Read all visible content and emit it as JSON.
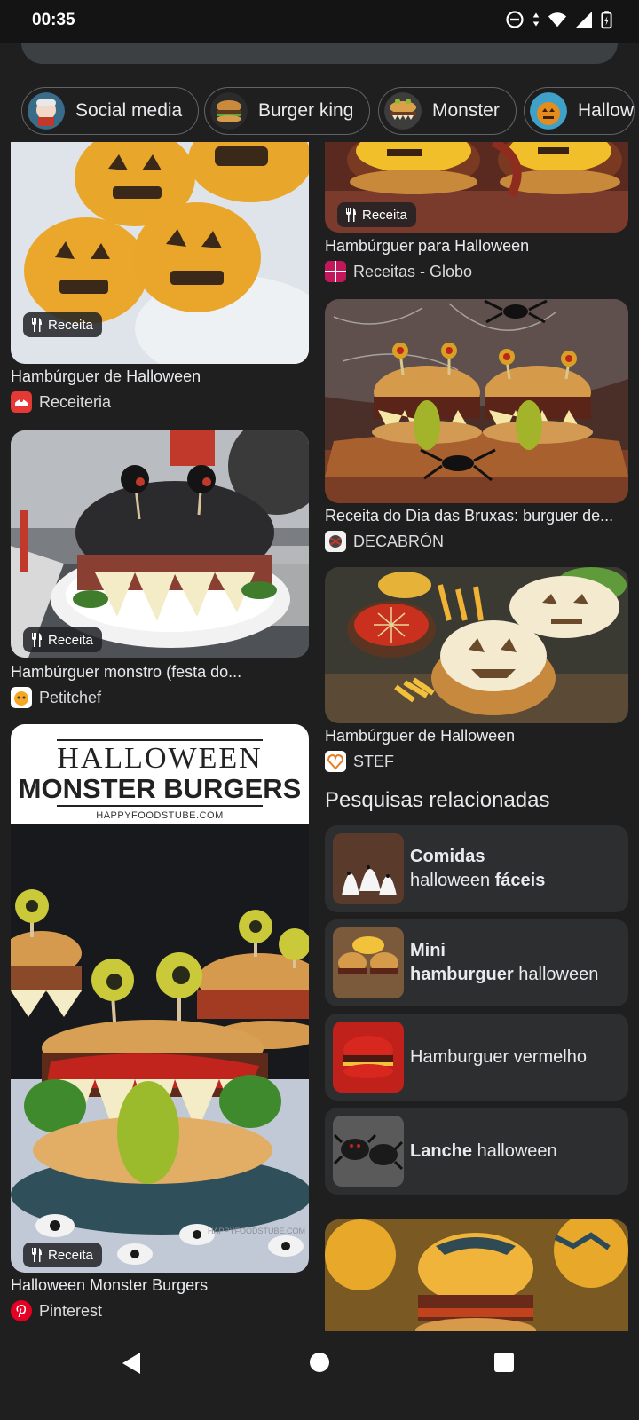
{
  "status_bar": {
    "time": "00:35",
    "icons": [
      "do-not-disturb-icon",
      "wifi-icon",
      "signal-icon",
      "battery-icon"
    ]
  },
  "chips": [
    {
      "label": "Social media",
      "thumb": "social-media-thumb"
    },
    {
      "label": "Burger king",
      "thumb": "burger-king-thumb"
    },
    {
      "label": "Monster",
      "thumb": "monster-thumb"
    },
    {
      "label": "Hallow",
      "thumb": "halloween-thumb"
    }
  ],
  "badge_label": "Receita",
  "left_column": [
    {
      "title": "Hambúrguer de Halloween",
      "source": "Receiteria"
    },
    {
      "title": "Hambúrguer monstro (festa do...",
      "source": "Petitchef"
    },
    {
      "title": "Halloween Monster Burgers",
      "source": "Pinterest",
      "image_text": {
        "line1": "HALLOWEEN",
        "line2": "MONSTER BURGERS",
        "site": "HAPPYFOODSTUBE.COM",
        "watermark": "HAPPYFOODSTUBE.COM"
      }
    }
  ],
  "right_column": [
    {
      "title": "Hambúrguer para Halloween",
      "source": "Receitas - Globo"
    },
    {
      "title": "Receita do Dia das Bruxas: burguer de...",
      "source": "DECABRÓN"
    },
    {
      "title": "Hambúrguer de Halloween",
      "source": "STEF"
    }
  ],
  "related": {
    "heading": "Pesquisas relacionadas",
    "items": [
      {
        "bold": "Comidas",
        "normal": "halloween",
        "bold2": "fáceis"
      },
      {
        "bold": "Mini",
        "bold_b": "hamburguer",
        "normal": "halloween"
      },
      {
        "normal": "Hamburguer vermelho"
      },
      {
        "bold": "Lanche",
        "normal": "halloween"
      }
    ]
  },
  "colors": {
    "background": "#1f1f1f",
    "card_bg": "#2d2e30",
    "text": "#e8eaed"
  }
}
